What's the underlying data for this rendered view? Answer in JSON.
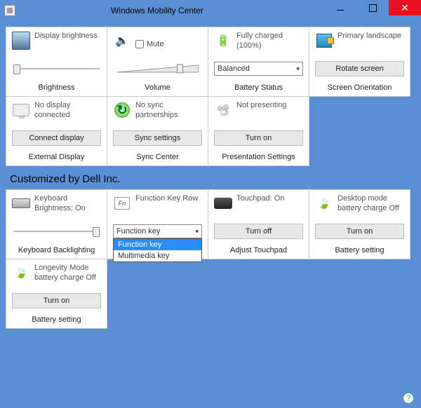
{
  "window": {
    "title": "Windows Mobility Center"
  },
  "tiles_top": [
    {
      "label": "Display brightness",
      "footer": "Brightness"
    },
    {
      "label": "Mute",
      "footer": "Volume"
    },
    {
      "label": "Fully charged (100%)",
      "combo": "Balanced",
      "footer": "Battery Status"
    },
    {
      "label": "Primary landscape",
      "button": "Rotate screen",
      "footer": "Screen Orientation"
    }
  ],
  "tiles_second": [
    {
      "label": "No display connected",
      "button": "Connect display",
      "footer": "External Display"
    },
    {
      "label": "No sync partnerships",
      "button": "Sync settings",
      "footer": "Sync Center"
    },
    {
      "label": "Not presenting",
      "button": "Turn on",
      "footer": "Presentation Settings"
    }
  ],
  "section_title": "Customized by Dell Inc.",
  "tiles_dell": [
    {
      "label": "Keyboard Brightness: On",
      "footer": "Keyboard Backlighting"
    },
    {
      "label": "Function Key Row",
      "combo": "Function key",
      "options": [
        "Function key",
        "Multimedia key"
      ],
      "footer": ""
    },
    {
      "label": "Touchpad: On",
      "button": "Turn off",
      "footer": "Adjust Touchpad"
    },
    {
      "label": "Desktop mode battery charge Off",
      "button": "Turn on",
      "footer": "Battery setting"
    }
  ],
  "tiles_dell2": [
    {
      "label": "Longevity Mode battery charge Off",
      "button": "Turn on",
      "footer": "Battery setting"
    }
  ]
}
